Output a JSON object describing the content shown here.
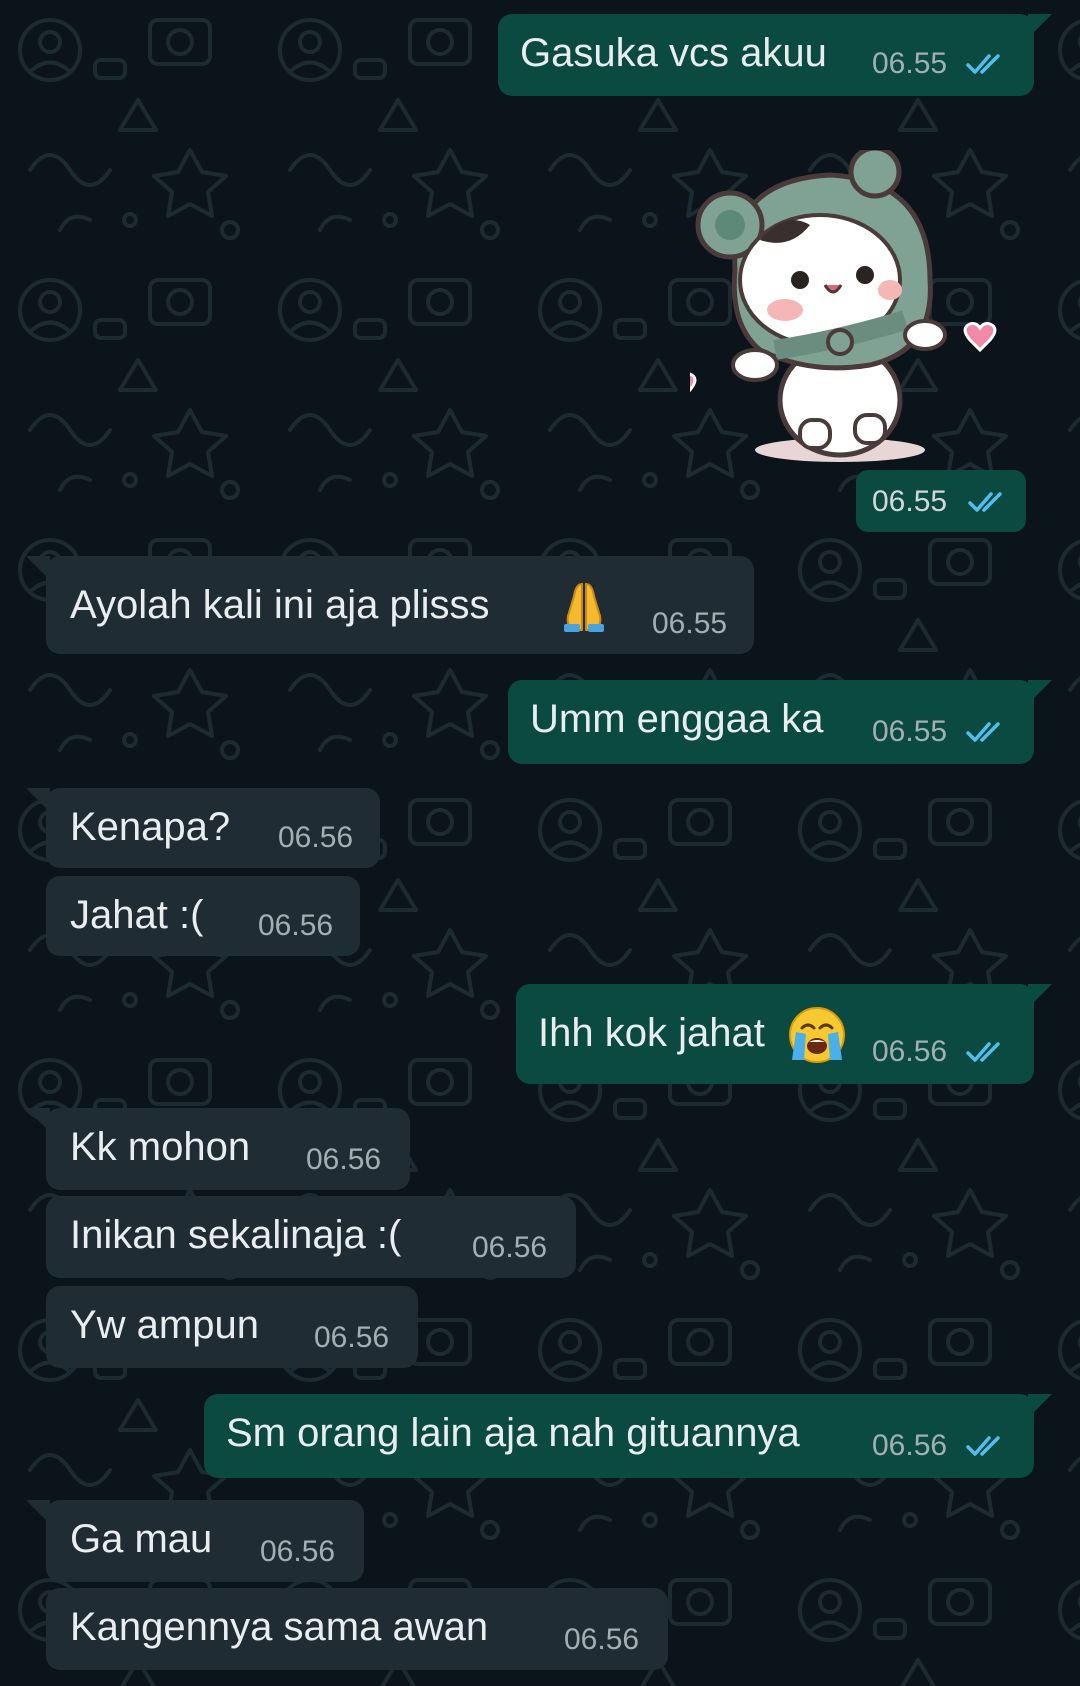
{
  "colors": {
    "background": "#0b141a",
    "outgoing_bubble": "#0a4a40",
    "incoming_bubble": "#202c33",
    "text": "#e9edef",
    "timestamp": "#a3afb5",
    "read_ticks": "#53bdeb"
  },
  "messages": [
    {
      "direction": "out",
      "text": "Gasuka vcs akuu",
      "time": "06.55",
      "status": "read"
    },
    {
      "direction": "out",
      "type": "sticker",
      "sticker": "bear-costume-sticker",
      "time": "06.55",
      "status": "read"
    },
    {
      "direction": "in",
      "text": "Ayolah kali ini aja plisss",
      "emoji": "folded-hands-emoji",
      "time": "06.55"
    },
    {
      "direction": "out",
      "text": "Umm enggaa ka",
      "time": "06.55",
      "status": "read"
    },
    {
      "direction": "in",
      "text": "Kenapa?",
      "time": "06.56"
    },
    {
      "direction": "in",
      "text": "Jahat :(",
      "time": "06.56"
    },
    {
      "direction": "out",
      "text": "Ihh kok jahat",
      "emoji": "loudly-crying-face-emoji",
      "time": "06.56",
      "status": "read"
    },
    {
      "direction": "in",
      "text": "Kk mohon",
      "time": "06.56"
    },
    {
      "direction": "in",
      "text": "Inikan sekalinaja :(",
      "time": "06.56"
    },
    {
      "direction": "in",
      "text": "Yw ampun",
      "time": "06.56"
    },
    {
      "direction": "out",
      "text": "Sm orang lain aja nah gituannya",
      "time": "06.56",
      "status": "read"
    },
    {
      "direction": "in",
      "text": "Ga mau",
      "time": "06.56"
    },
    {
      "direction": "in",
      "text": "Kangennya sama awan",
      "time": "06.56"
    }
  ]
}
